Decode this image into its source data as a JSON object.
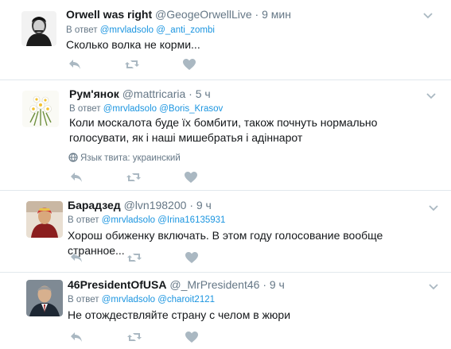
{
  "tweets": [
    {
      "name": "Orwell was right",
      "handle": "@GeogeOrwellLive",
      "separator": "·",
      "time": "9 мин",
      "reply_prefix": "В ответ",
      "mentions": [
        "@mrvladsolo",
        "@_anti_zombi"
      ],
      "text": "Сколько волка не корми...",
      "lang": ""
    },
    {
      "name": "Рум'янок",
      "handle": "@mattricaria",
      "separator": "·",
      "time": "5 ч",
      "reply_prefix": "В ответ",
      "mentions": [
        "@mrvladsolo",
        "@Boris_Krasov"
      ],
      "text": "Коли москалота буде їх бомбити, також почнуть нормально голосувати, як і наші мишебратья і адіннарот",
      "lang": "Язык твита: украинский"
    },
    {
      "name": "Барадзед",
      "handle": "@lvn198200",
      "separator": "·",
      "time": "9 ч",
      "reply_prefix": "В ответ",
      "mentions": [
        "@mrvladsolo",
        "@Irina16135931"
      ],
      "text": "Хорош обиженку включать. В этом году голосование вообще странное...",
      "lang": ""
    },
    {
      "name": "46PresidentOfUSA",
      "handle": "@_MrPresident46",
      "separator": "·",
      "time": "9 ч",
      "reply_prefix": "В ответ",
      "mentions": [
        "@mrvladsolo",
        "@charoit2121"
      ],
      "text": "Не отождествляйте страну с челом в жюри",
      "lang": ""
    }
  ],
  "icons": {
    "reply": "reply-icon",
    "retweet": "retweet-icon",
    "like": "heart-icon",
    "caret": "chevron-down-icon",
    "globe": "globe-icon"
  },
  "colors": {
    "text": "#14171a",
    "secondary": "#657786",
    "link": "#1b95e0",
    "divider": "#e1e8ed",
    "icon": "#aab8c2"
  }
}
